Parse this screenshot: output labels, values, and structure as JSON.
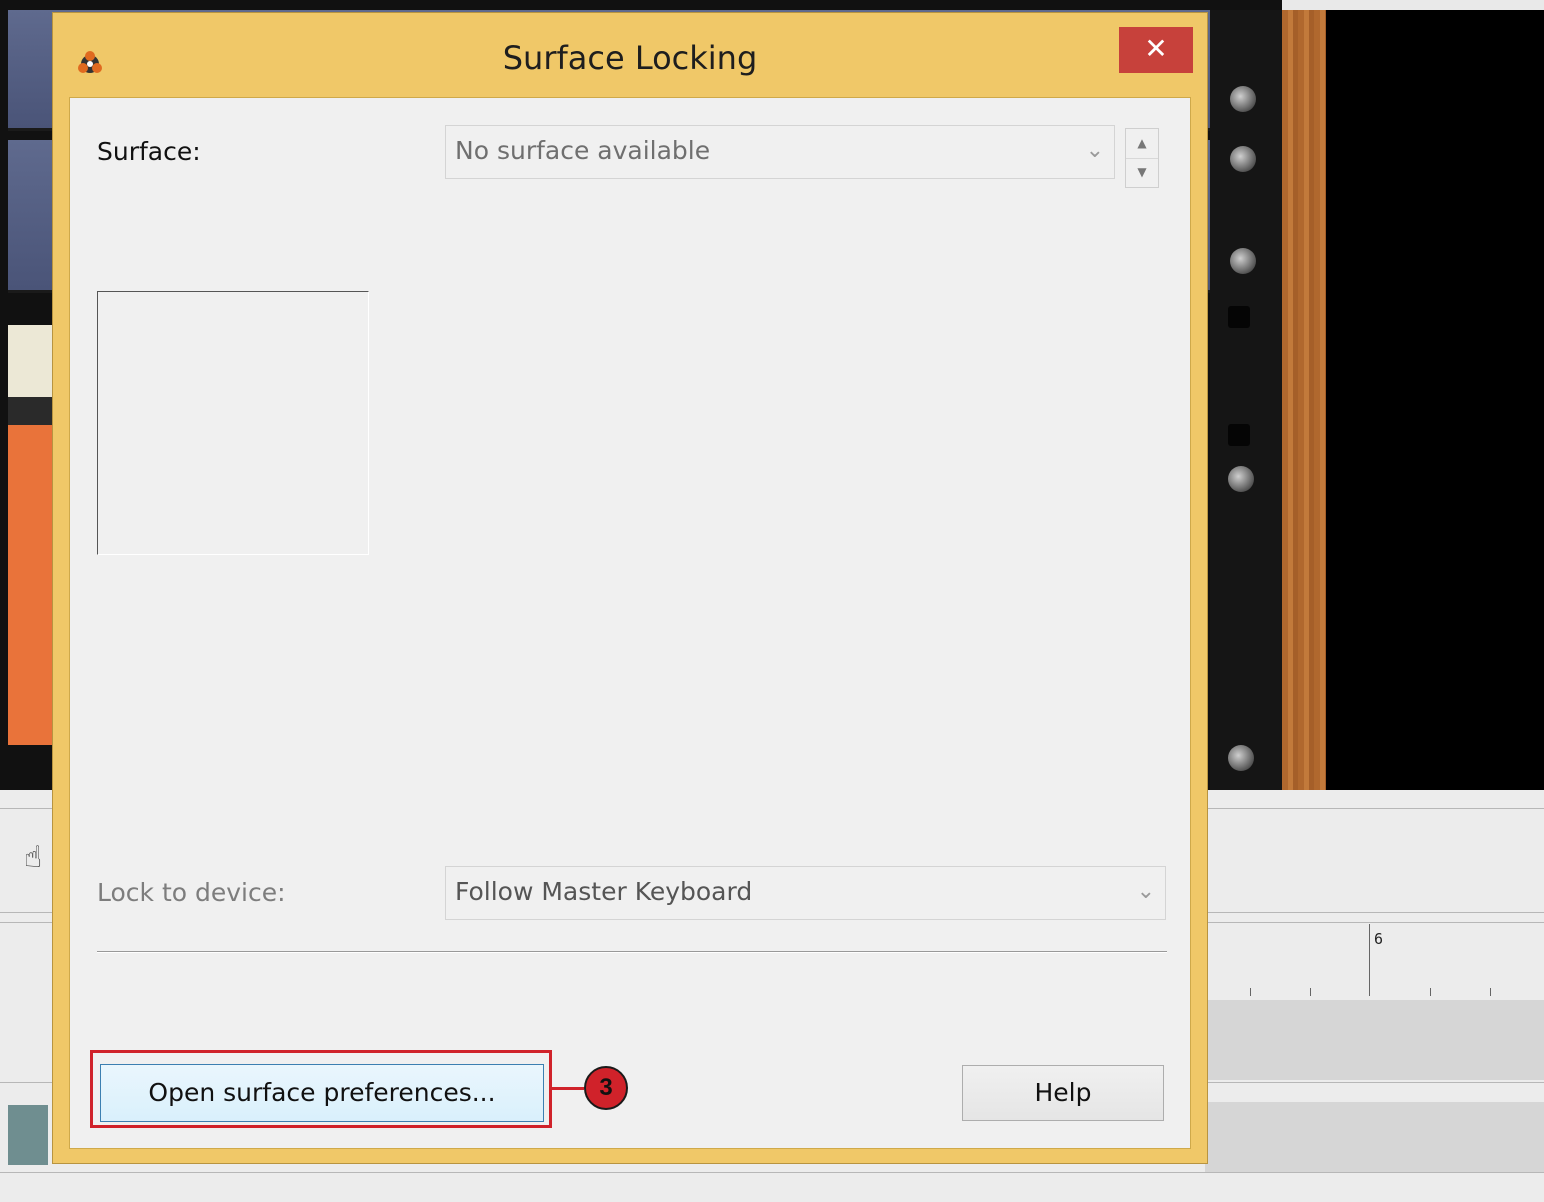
{
  "dialog": {
    "title": "Surface Locking",
    "close_glyph": "✕",
    "surface_label": "Surface:",
    "surface_value": "No surface available",
    "lock_label": "Lock to device:",
    "lock_value": "Follow Master Keyboard",
    "open_prefs_button": "Open surface preferences...",
    "help_button": "Help"
  },
  "background": {
    "ruler_bar": "6"
  },
  "annotation": {
    "step_number": "3"
  },
  "colors": {
    "dialog_frame": "#f0c868",
    "close_button": "#c7413b",
    "callout": "#d0222a"
  },
  "icons": [
    "app-logo-icon",
    "close-icon",
    "chevron-down-icon",
    "spin-up-icon",
    "spin-down-icon",
    "hand-icon"
  ]
}
